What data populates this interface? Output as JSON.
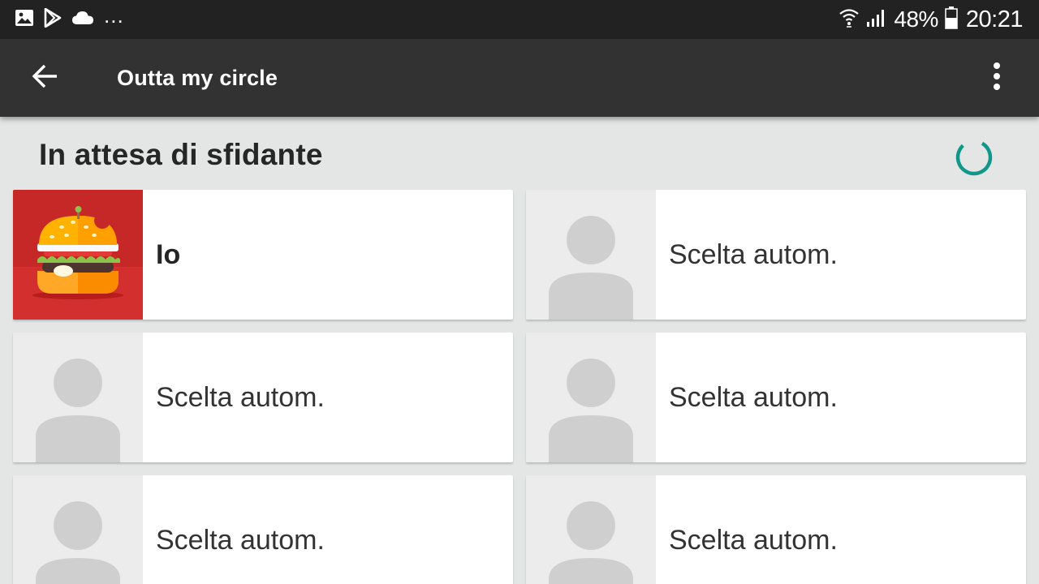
{
  "status_bar": {
    "left_icons": [
      "image-icon",
      "play-store-icon",
      "cloud-icon"
    ],
    "more_indicator": "...",
    "battery_percent": "48%",
    "time": "20:21"
  },
  "app_bar": {
    "title": "Outta my circle"
  },
  "section": {
    "title": "In attesa di sfidante"
  },
  "colors": {
    "status_bar": "#222222",
    "app_bar": "#323232",
    "spinner": "#11978a",
    "my_avatar_bg": "#c62828"
  },
  "slots": [
    {
      "label": "Io",
      "is_me": true,
      "avatar": "burger-avatar"
    },
    {
      "label": "Scelta autom.",
      "is_me": false,
      "avatar": "person-placeholder"
    },
    {
      "label": "Scelta autom.",
      "is_me": false,
      "avatar": "person-placeholder"
    },
    {
      "label": "Scelta autom.",
      "is_me": false,
      "avatar": "person-placeholder"
    },
    {
      "label": "Scelta autom.",
      "is_me": false,
      "avatar": "person-placeholder"
    },
    {
      "label": "Scelta autom.",
      "is_me": false,
      "avatar": "person-placeholder"
    }
  ]
}
